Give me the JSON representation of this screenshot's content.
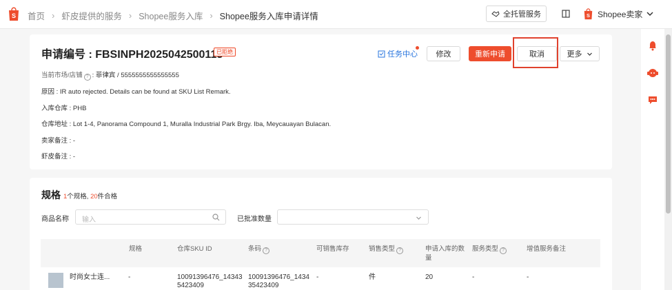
{
  "breadcrumb": [
    "首页",
    "虾皮提供的服务",
    "Shopee服务入库",
    "Shopee服务入库申请详情"
  ],
  "topbar": {
    "trust_label": "全托管服务",
    "seller_label": "Shopee卖家"
  },
  "request": {
    "title": "申请编号 : FBSINPH2025042500113",
    "status": "已拒绝",
    "task_center": "任务中心",
    "edit": "修改",
    "resubmit": "重新申请",
    "cancel": "取消",
    "more": "更多",
    "market_label": "当前市场/店铺",
    "market_value": ": 菲律宾 / 5555555555555555",
    "reason": "原因 :  IR auto rejected. Details can be found at SKU List Remark.",
    "warehouse": "入库仓库 :  PHB",
    "address": "仓库地址 :  Lot 1-4, Panorama Compound 1, Muralla Industrial Park Brgy. Iba, Meycauayan Bulacan.",
    "seller_note": "卖家备注 :  -",
    "shopee_note": "虾皮备注 :  -"
  },
  "spec": {
    "title": "规格",
    "count_n": "1",
    "count_mid": "个规格, ",
    "qty_n": "20",
    "qty_tail": "件合格",
    "name_label": "商品名称",
    "name_placeholder": "输入",
    "approved_label": "已批准数量",
    "columns": [
      "规格",
      "仓库SKU ID",
      "条码",
      "可销售库存",
      "销售类型",
      "申请入库的数量",
      "服务类型",
      "增值服务备注"
    ],
    "row": {
      "name": "时尚女士连...",
      "spec": "-",
      "sku_id": [
        "10091396476_14343",
        "5423409"
      ],
      "barcode": [
        "10091396476_1434",
        "35423409"
      ],
      "stock": "-",
      "sale_type": "件",
      "qty": "20",
      "service": "-",
      "remark": "-"
    }
  },
  "colors": {
    "brand": "#ee4d2d",
    "link": "#2673dd"
  }
}
